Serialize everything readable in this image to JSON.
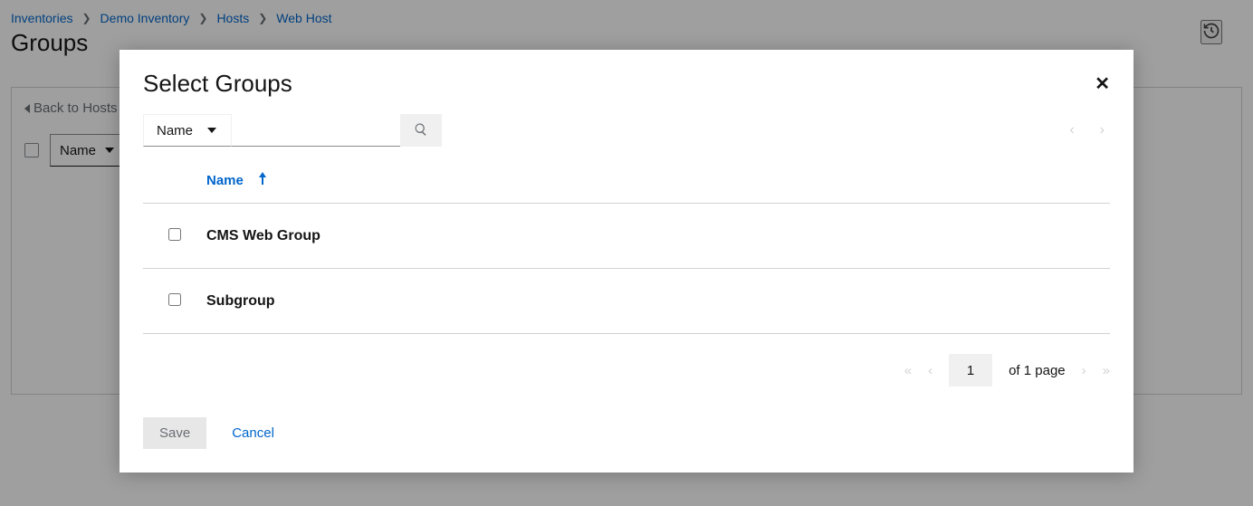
{
  "breadcrumb": {
    "items": [
      "Inventories",
      "Demo Inventory",
      "Hosts",
      "Web Host"
    ]
  },
  "page": {
    "title": "Groups",
    "back_link": "Back to Hosts",
    "filter_label": "Name"
  },
  "modal": {
    "title": "Select Groups",
    "filter_label": "Name",
    "search_value": "",
    "column_header": "Name",
    "rows": [
      {
        "name": "CMS Web Group"
      },
      {
        "name": "Subgroup"
      }
    ],
    "pagination": {
      "page_input": "1",
      "of_text": "of 1 page"
    },
    "save_label": "Save",
    "cancel_label": "Cancel"
  }
}
